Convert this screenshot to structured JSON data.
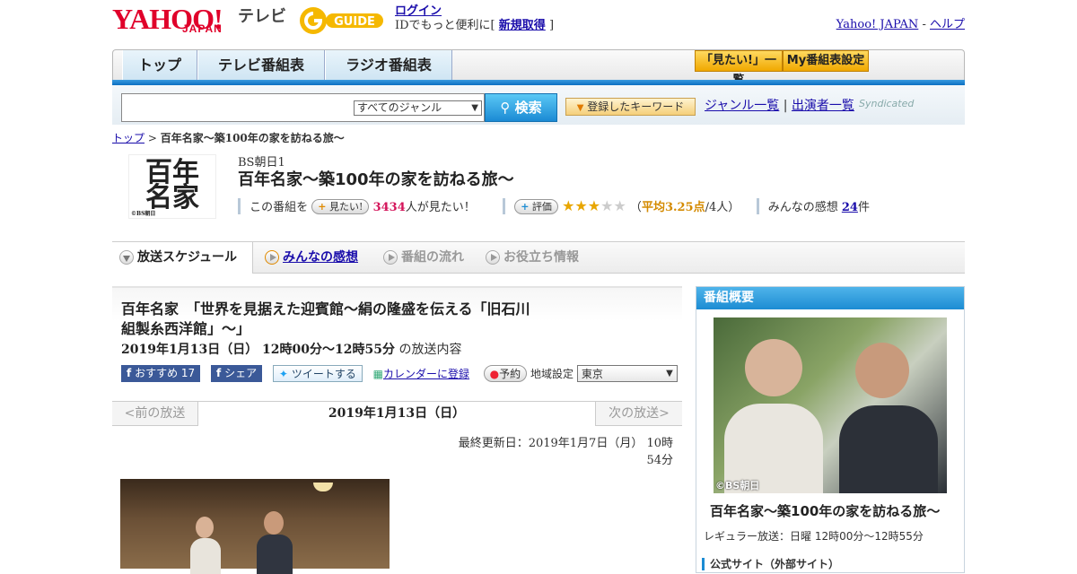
{
  "header": {
    "logo_text": "YAHOO!",
    "logo_sub": "JAPAN",
    "service_name": "テレビ",
    "gguide": "GUIDE",
    "login_label": "ログイン",
    "login_promo": "IDでもっと便利に[",
    "register_label": "新規取得",
    "register_close": "]",
    "yahoo_japan": "Yahoo! JAPAN",
    "help": "ヘルプ",
    "sep": "-"
  },
  "nav": {
    "tabs": [
      {
        "label": "トップ"
      },
      {
        "label": "テレビ番組表"
      },
      {
        "label": "ラジオ番組表"
      }
    ],
    "mitai_list": "「見たい!」一覧",
    "my_schedule": "My番組表設定"
  },
  "search": {
    "genre_select": "すべてのジャンル",
    "search_button": "検索",
    "keyword_button": "登録したキーワード",
    "genre_list": "ジャンル一覧",
    "performer_list": "出演者一覧",
    "divider": "|",
    "syndicated": "Syndicated"
  },
  "breadcrumb": {
    "top": "トップ",
    "sep": ">",
    "current": "百年名家～築100年の家を訪ねる旅～"
  },
  "program": {
    "thumb_text": "百年名家",
    "thumb_credit": "©BS朝日",
    "channel": "BS朝日1",
    "title": "百年名家～築100年の家を訪ねる旅～",
    "want_prefix": "この番組を",
    "want_button": "見たい!",
    "want_count": "3434",
    "want_suffix": "人が見たい！",
    "rate_button": "評価",
    "rating_value": 3.25,
    "rating_open": "（",
    "rating_label": "平均3.25点",
    "rating_count": "/4人）",
    "comments_prefix": "みんなの感想",
    "comments_count": "24",
    "comments_suffix": "件"
  },
  "section_tabs": [
    {
      "label": "放送スケジュール"
    },
    {
      "label": "みんなの感想"
    },
    {
      "label": "番組の流れ"
    },
    {
      "label": "お役立ち情報"
    }
  ],
  "episode": {
    "title": "百年名家　「世界を見据えた迎賓館～絹の隆盛を伝える「旧石川組製糸西洋館」～」",
    "datetime": "2019年1月13日（日）  12時00分～12時55分",
    "datetime_suffix": "の放送内容",
    "recommend": "おすすめ",
    "recommend_count": "17",
    "share": "シェア",
    "tweet": "ツイートする",
    "calendar": "カレンダーに登録",
    "reserve": "予約",
    "region_label": "地域設定",
    "region_value": "東京"
  },
  "pager": {
    "prev": "<前の放送",
    "current": "2019年1月13日（日）",
    "next": "次の放送>"
  },
  "updated": "最終更新日：2019年1月7日（月）  10時54分",
  "sidebar": {
    "heading": "番組概要",
    "photo_credit": "©BS朝日",
    "title": "百年名家～築100年の家を訪ねる旅～",
    "regular": "レギュラー放送：日曜 12時00分～12時55分",
    "official": "公式サイト（外部サイト）"
  },
  "colors": {
    "accent": "#1c8cd3",
    "yahoo_red": "#e0002a",
    "gguide_yellow": "#f5b800",
    "want_count": "#d4145a",
    "rating": "#d48a00"
  }
}
